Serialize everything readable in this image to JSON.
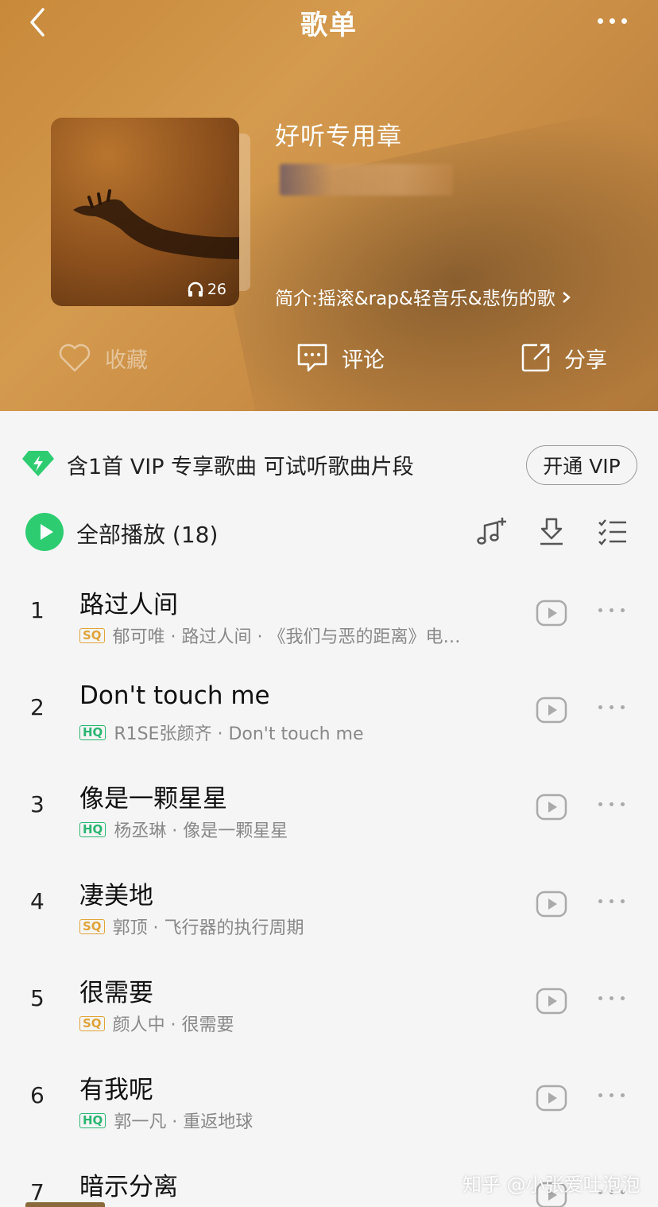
{
  "header": {
    "title": "歌单",
    "playlist_name": "好听专用章",
    "play_count": "26",
    "intro": "简介:摇滚&rap&轻音乐&悲伤的歌",
    "actions": {
      "favorite": "收藏",
      "comment": "评论",
      "share": "分享"
    }
  },
  "vip": {
    "text": "含1首 VIP 专享歌曲 可试听歌曲片段",
    "button": "开通 VIP"
  },
  "play_all": {
    "label": "全部播放",
    "count": "(18)"
  },
  "songs": [
    {
      "index": "1",
      "title": "路过人间",
      "quality": "SQ",
      "meta": "郁可唯 · 路过人间 · 《我们与恶的距离》电…"
    },
    {
      "index": "2",
      "title": "Don't touch me",
      "quality": "HQ",
      "meta": "R1SE张颜齐 · Don't touch me"
    },
    {
      "index": "3",
      "title": "像是一颗星星",
      "quality": "HQ",
      "meta": "杨丞琳 · 像是一颗星星"
    },
    {
      "index": "4",
      "title": "凄美地",
      "quality": "SQ",
      "meta": "郭顶 · 飞行器的执行周期"
    },
    {
      "index": "5",
      "title": "很需要",
      "quality": "SQ",
      "meta": "颜人中 · 很需要"
    },
    {
      "index": "6",
      "title": "有我呢",
      "quality": "HQ",
      "meta": "郭一凡 · 重返地球"
    },
    {
      "index": "7",
      "title": "暗示分离",
      "quality": "",
      "meta": ""
    }
  ],
  "watermark": "知乎 @小张爱吐泡泡",
  "colors": {
    "accent_green": "#2ecc71",
    "sq": "#e0a43a",
    "hq": "#2bb673",
    "header_bg": "#c8893a"
  }
}
